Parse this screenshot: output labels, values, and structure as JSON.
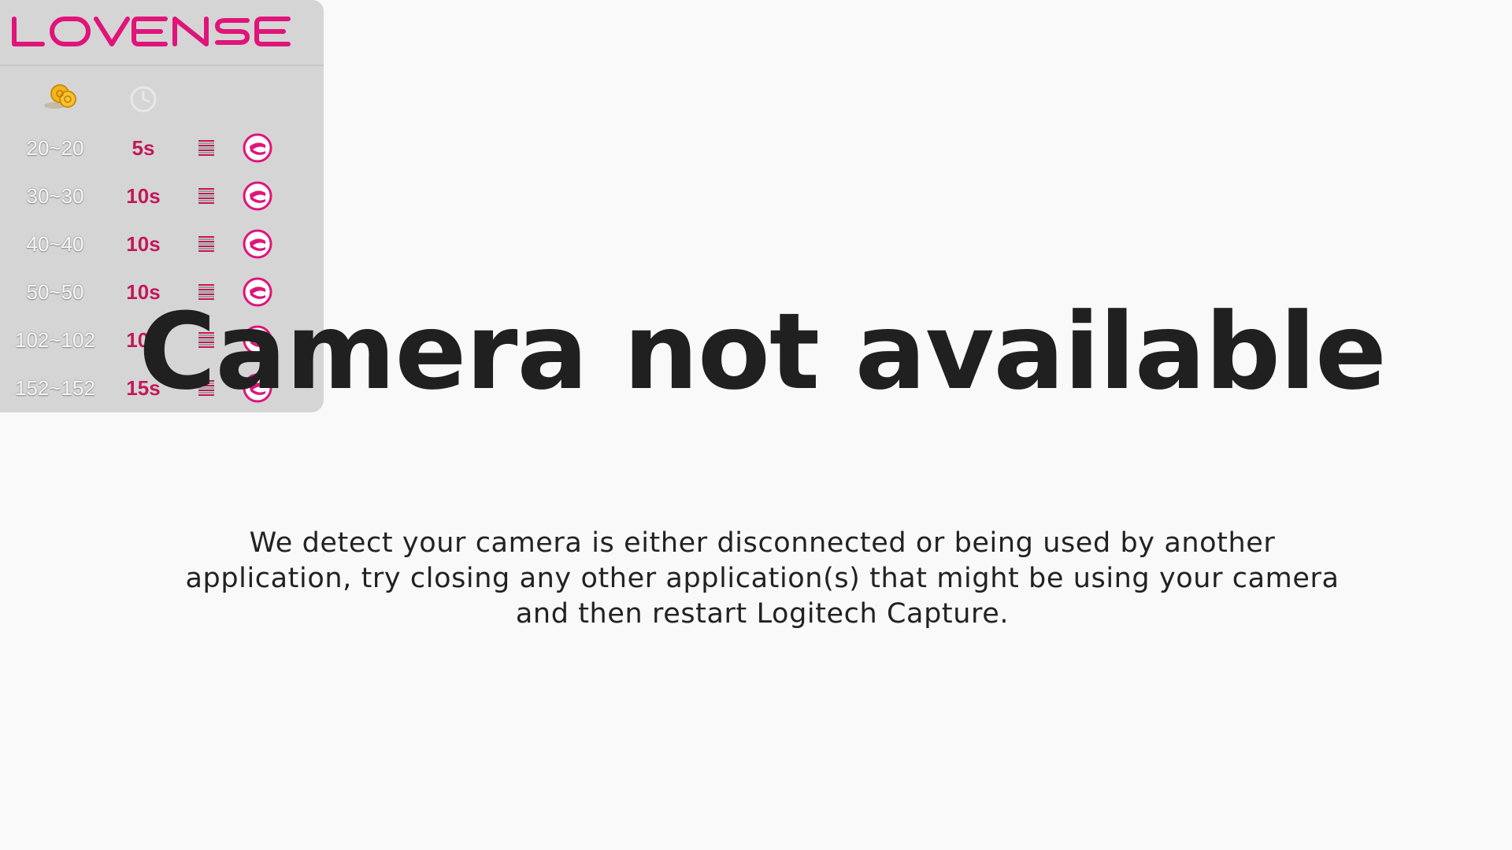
{
  "brand": {
    "name": "LOVENSE",
    "accent": "#e0147a",
    "duration_color": "#c2185b"
  },
  "panel": {
    "header_icons": [
      "coin-icon",
      "clock-icon"
    ],
    "levels": [
      {
        "range": "20~20",
        "duration": "5s",
        "icon": "vibration-level-icon",
        "toy_icon": "lovense-toy-icon"
      },
      {
        "range": "30~30",
        "duration": "10s",
        "icon": "vibration-level-icon",
        "toy_icon": "lovense-toy-icon"
      },
      {
        "range": "40~40",
        "duration": "10s",
        "icon": "vibration-level-icon",
        "toy_icon": "lovense-toy-icon"
      },
      {
        "range": "50~50",
        "duration": "10s",
        "icon": "vibration-level-icon",
        "toy_icon": "lovense-toy-icon"
      },
      {
        "range": "102~102",
        "duration": "10s",
        "icon": "vibration-level-icon",
        "toy_icon": "lovense-toy-icon"
      },
      {
        "range": "152~152",
        "duration": "15s",
        "icon": "vibration-level-icon",
        "toy_icon": "lovense-toy-icon"
      }
    ]
  },
  "main": {
    "headline": "Camera not available",
    "message": "We detect your camera is either disconnected or being used by another application, try closing any other application(s) that might be using your camera and then restart Logitech Capture."
  }
}
